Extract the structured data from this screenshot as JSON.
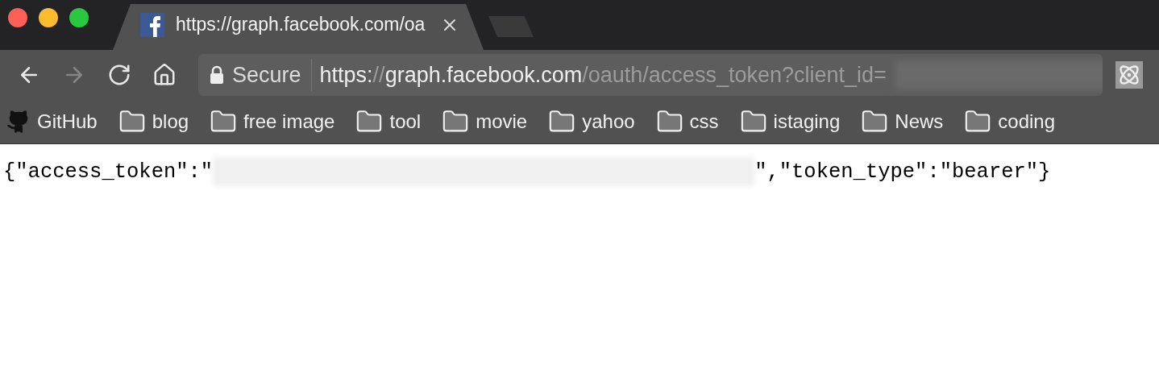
{
  "window": {
    "traffic_lights": [
      {
        "color": "#fc5f57"
      },
      {
        "color": "#fdbc2e"
      },
      {
        "color": "#28c840"
      }
    ]
  },
  "tabs": [
    {
      "title": "https://graph.facebook.com/oa",
      "selected": true
    }
  ],
  "toolbar": {
    "forward_disabled": true,
    "security": "Secure",
    "url": {
      "scheme": "https:",
      "slashes": "//",
      "host": "graph.facebook.com",
      "path": "/oauth/access_token?client_id="
    }
  },
  "bookmarks": [
    {
      "kind": "github",
      "label": "GitHub"
    },
    {
      "kind": "folder",
      "label": "blog"
    },
    {
      "kind": "folder",
      "label": "free image"
    },
    {
      "kind": "folder",
      "label": "tool"
    },
    {
      "kind": "folder",
      "label": "movie"
    },
    {
      "kind": "folder",
      "label": "yahoo"
    },
    {
      "kind": "folder",
      "label": "css"
    },
    {
      "kind": "folder",
      "label": "istaging"
    },
    {
      "kind": "folder",
      "label": "News"
    },
    {
      "kind": "folder",
      "label": "coding"
    }
  ],
  "page": {
    "before": "{\"access_token\":\"",
    "after": "\",\"token_type\":\"bearer\"}"
  }
}
